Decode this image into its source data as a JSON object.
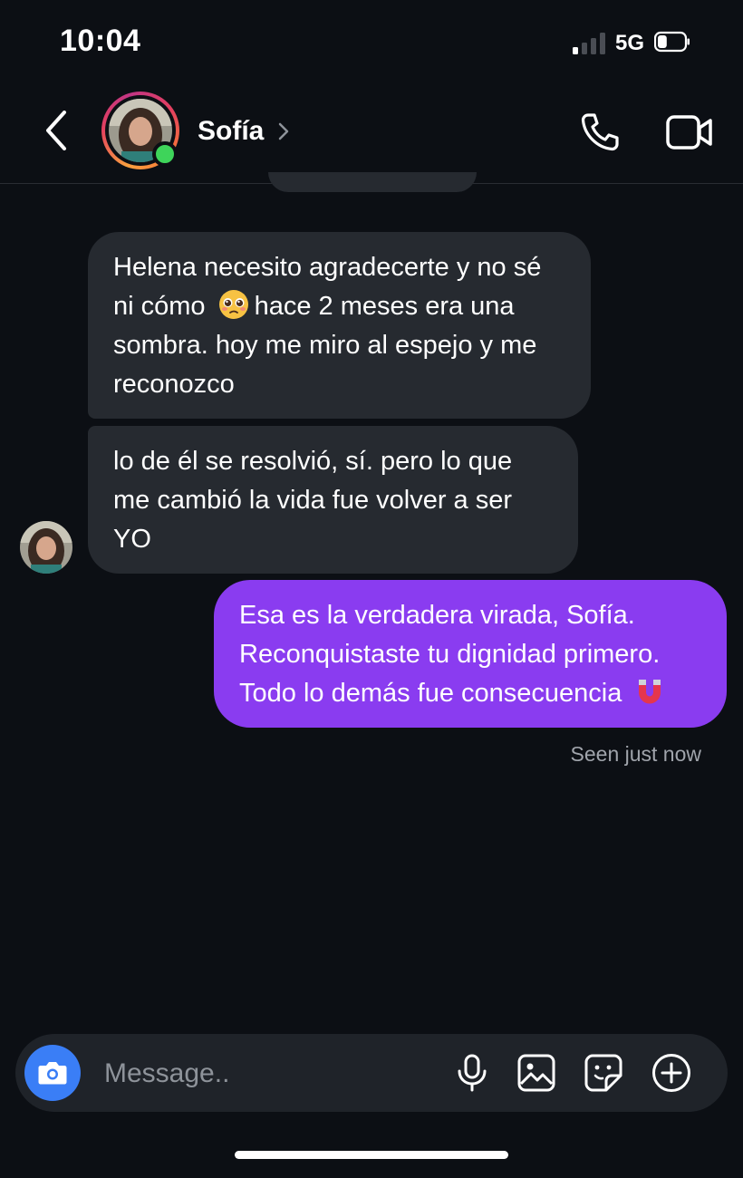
{
  "status_bar": {
    "time": "10:04",
    "network": "5G",
    "signal_bars_active": 1,
    "signal_bars_total": 4,
    "battery_level": 0.35
  },
  "header": {
    "contact_name": "Sofía",
    "online": true,
    "icons": [
      "back-chevron-icon",
      "phone-icon",
      "video-camera-icon",
      "chevron-right-icon"
    ]
  },
  "messages": [
    {
      "direction": "incoming",
      "text_before_emoji": "Helena necesito agradecerte y no sé ni cómo",
      "emoji": "pleading-face",
      "text_after_emoji": "hace 2 meses era una sombra. hoy me miro al espejo y me reconozco"
    },
    {
      "direction": "incoming",
      "text": "lo de él se resolvió, sí. pero lo que me cambió la vida fue volver a ser YO"
    },
    {
      "direction": "outgoing",
      "text": "Esa es la verdadera virada, Sofía. Reconquistaste tu dignidad primero. Todo lo demás fue consecuencia",
      "emoji": "magnet"
    }
  ],
  "seen_status": "Seen just now",
  "composer": {
    "placeholder": "Message..",
    "icons": [
      "camera-icon",
      "microphone-icon",
      "gallery-icon",
      "sticker-icon",
      "add-icon"
    ]
  },
  "colors": {
    "background": "#0c0f14",
    "incoming_bubble": "#262a30",
    "outgoing_bubble": "#8a3cf0",
    "camera_button": "#3a7ef6",
    "online_indicator": "#3ed45a"
  }
}
